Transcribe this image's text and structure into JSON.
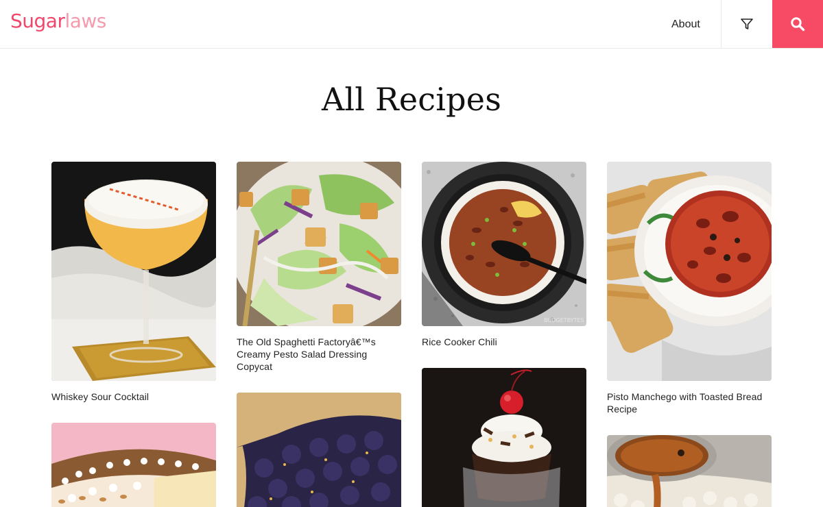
{
  "brand": {
    "name_part1": "Sugar",
    "name_part2": "laws"
  },
  "nav": {
    "about_label": "About",
    "filter_icon": "filter-icon",
    "search_icon": "search-icon"
  },
  "page": {
    "title": "All Recipes"
  },
  "recipes": [
    {
      "title": "Whiskey Sour Cocktail"
    },
    {
      "title": "The Old Spaghetti Factoryâ€™s Creamy Pesto Salad Dressing Copycat"
    },
    {
      "title": "Rice Cooker Chili"
    },
    {
      "title": "Pisto Manchego with Toasted Bread Recipe"
    },
    {
      "title": ""
    },
    {
      "title": ""
    },
    {
      "title": ""
    },
    {
      "title": ""
    }
  ],
  "image_watermarks": {
    "chili": "BUDGETBYTES"
  },
  "colors": {
    "brand_primary": "#f2476a",
    "brand_light": "#f59aac",
    "search_bg": "#f74a64"
  }
}
